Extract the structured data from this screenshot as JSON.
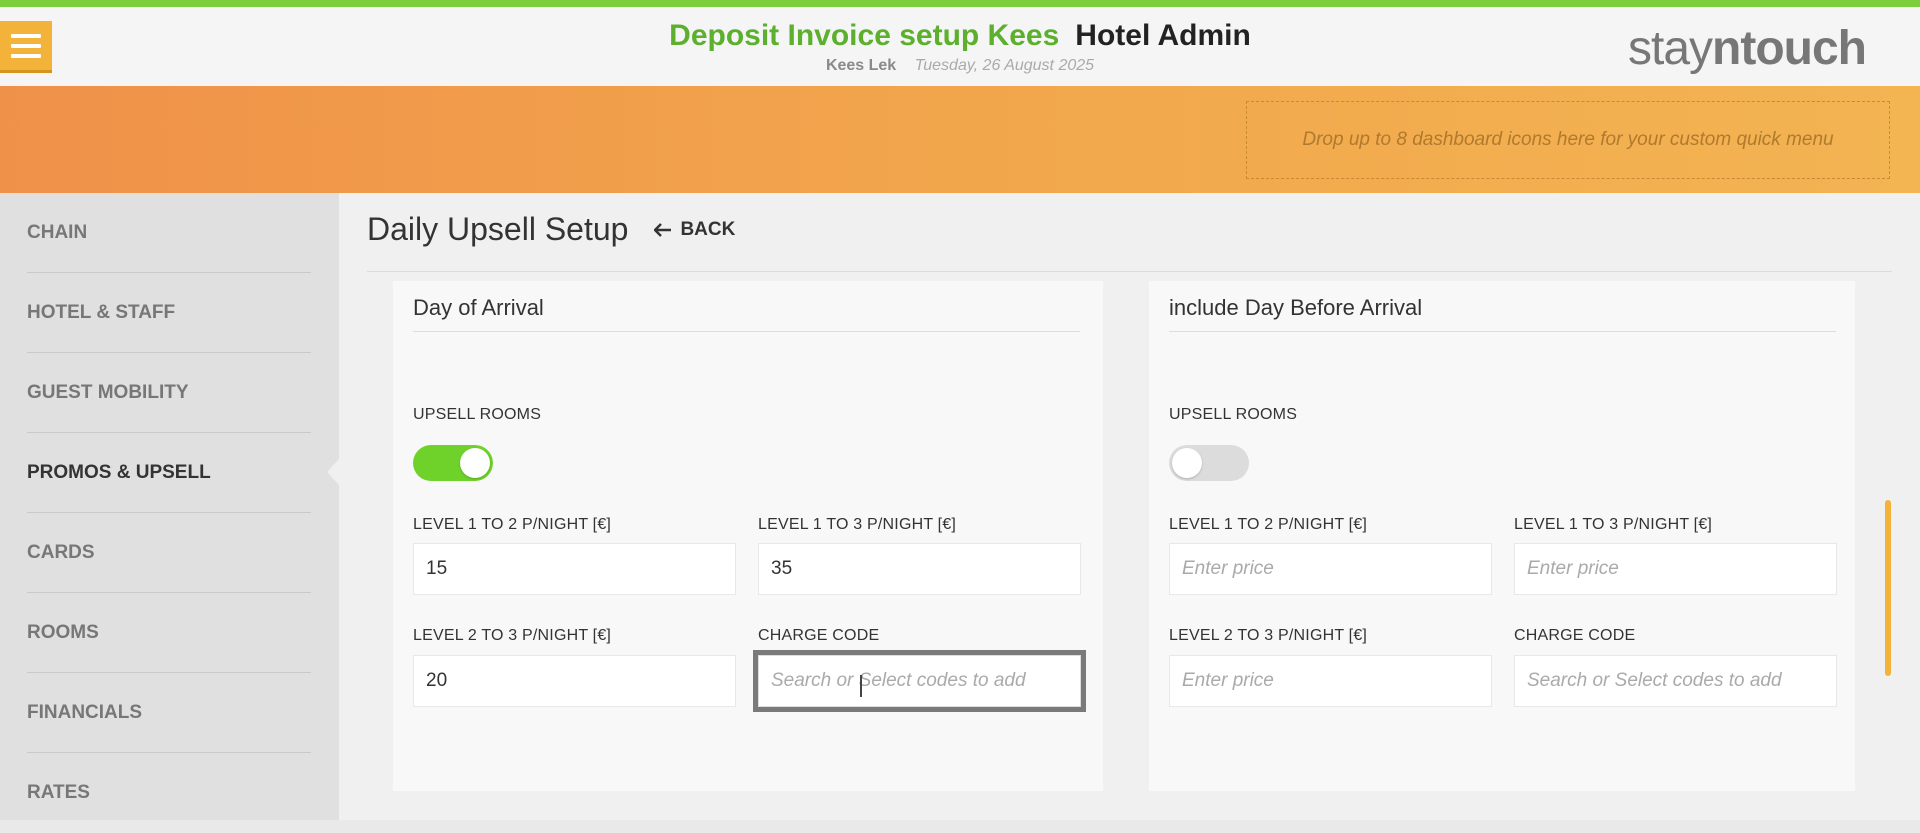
{
  "header": {
    "title_green": "Deposit Invoice setup Kees",
    "title_dark": "Hotel Admin",
    "user": "Kees Lek",
    "date": "Tuesday, 26 August 2025",
    "logo_start": "stay",
    "logo_n": "n",
    "logo_end": "touch"
  },
  "banner": {
    "dropzone_text": "Drop up to 8 dashboard icons here for your custom quick menu"
  },
  "sidebar": {
    "items": [
      {
        "label": "CHAIN"
      },
      {
        "label": "HOTEL & STAFF"
      },
      {
        "label": "GUEST MOBILITY"
      },
      {
        "label": "PROMOS & UPSELL",
        "active": true
      },
      {
        "label": "CARDS"
      },
      {
        "label": "ROOMS"
      },
      {
        "label": "FINANCIALS"
      },
      {
        "label": "RATES"
      }
    ]
  },
  "page": {
    "title": "Daily Upsell Setup",
    "back_label": "BACK"
  },
  "left_panel": {
    "title": "Day of Arrival",
    "upsell_label": "UPSELL ROOMS",
    "toggle_on": true,
    "l1_l2_label": "LEVEL 1 TO 2 P/NIGHT [€]",
    "l1_l2_value": "15",
    "l1_l3_label": "LEVEL 1 TO 3 P/NIGHT [€]",
    "l1_l3_value": "35",
    "l2_l3_label": "LEVEL 2 TO 3 P/NIGHT [€]",
    "l2_l3_value": "20",
    "charge_label": "CHARGE CODE",
    "charge_placeholder": "Search or Select codes to add"
  },
  "right_panel": {
    "title": "include Day Before Arrival",
    "upsell_label": "UPSELL ROOMS",
    "toggle_on": false,
    "l1_l2_label": "LEVEL 1 TO 2 P/NIGHT [€]",
    "l1_l2_placeholder": "Enter price",
    "l1_l3_label": "LEVEL 1 TO 3 P/NIGHT [€]",
    "l1_l3_placeholder": "Enter price",
    "l2_l3_label": "LEVEL 2 TO 3 P/NIGHT [€]",
    "l2_l3_placeholder": "Enter price",
    "charge_label": "CHARGE CODE",
    "charge_placeholder": "Search or Select codes to add"
  },
  "colors": {
    "accent_green": "#5cb02d",
    "toggle_green": "#6fd22a",
    "orange": "#f3b23a"
  },
  "icons": {
    "menu": "hamburger-icon",
    "back": "arrow-left-icon"
  }
}
